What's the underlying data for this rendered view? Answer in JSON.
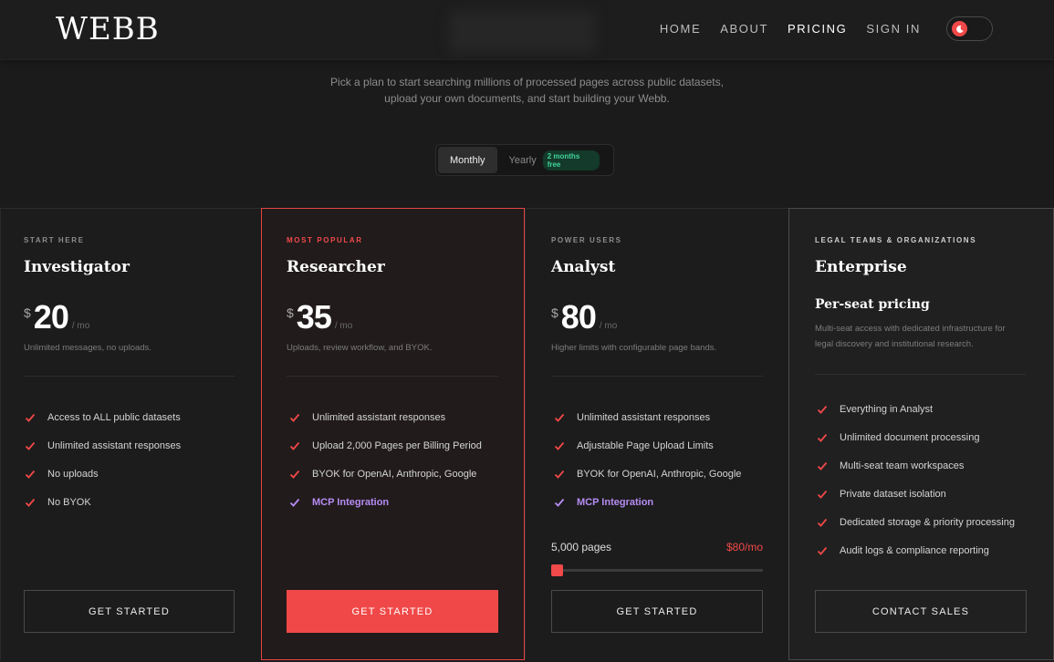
{
  "brand": {
    "logo": "WEBB"
  },
  "nav": {
    "links": [
      {
        "label": "HOME"
      },
      {
        "label": "ABOUT"
      },
      {
        "label": "PRICING",
        "active": true
      },
      {
        "label": "SIGN IN"
      }
    ],
    "theme_toggle_icon": "moon-icon"
  },
  "intro": {
    "line1": "Pick a plan to start searching millions of processed pages across public datasets,",
    "line2": "upload your own documents, and start building your Webb."
  },
  "billing": {
    "monthly_label": "Monthly",
    "yearly_label": "Yearly",
    "yearly_badge": "2 months free",
    "selected": "Monthly"
  },
  "plans": [
    {
      "eyebrow": "START HERE",
      "name": "Investigator",
      "currency": "$",
      "price": "20",
      "period": "/ mo",
      "subtitle": "Unlimited messages, no uploads.",
      "features": [
        "Access to ALL public datasets",
        "Unlimited assistant responses",
        "No uploads",
        "No BYOK"
      ],
      "cta": "GET STARTED"
    },
    {
      "eyebrow": "MOST POPULAR",
      "name": "Researcher",
      "currency": "$",
      "price": "35",
      "period": "/ mo",
      "subtitle": "Uploads, review workflow, and BYOK.",
      "features": [
        "Unlimited assistant responses",
        "Upload 2,000 Pages per Billing Period",
        "BYOK for OpenAI, Anthropic, Google",
        "MCP Integration"
      ],
      "cta": "GET STARTED"
    },
    {
      "eyebrow": "POWER USERS",
      "name": "Analyst",
      "currency": "$",
      "price": "80",
      "period": "/ mo",
      "subtitle": "Higher limits with configurable page bands.",
      "features": [
        "Unlimited assistant responses",
        "Adjustable Page Upload Limits",
        "BYOK for OpenAI, Anthropic, Google",
        "MCP Integration"
      ],
      "slider": {
        "label": "5,000 pages",
        "value": "$80/mo",
        "level": 0
      },
      "cta": "GET STARTED"
    },
    {
      "eyebrow": "LEGAL TEAMS & ORGANIZATIONS",
      "name": "Enterprise",
      "pricing_title": "Per-seat pricing",
      "description": "Multi-seat access with dedicated infrastructure for legal discovery and institutional research.",
      "features": [
        "Everything in Analyst",
        "Unlimited document processing",
        "Multi-seat team workspaces",
        "Private dataset isolation",
        "Dedicated storage & priority processing",
        "Audit logs & compliance reporting"
      ],
      "cta": "CONTACT SALES"
    }
  ],
  "colors": {
    "accent": "#f04848",
    "mcp": "#b68cf4",
    "badge_green": "#43d39a",
    "background": "#1b1b1b"
  }
}
